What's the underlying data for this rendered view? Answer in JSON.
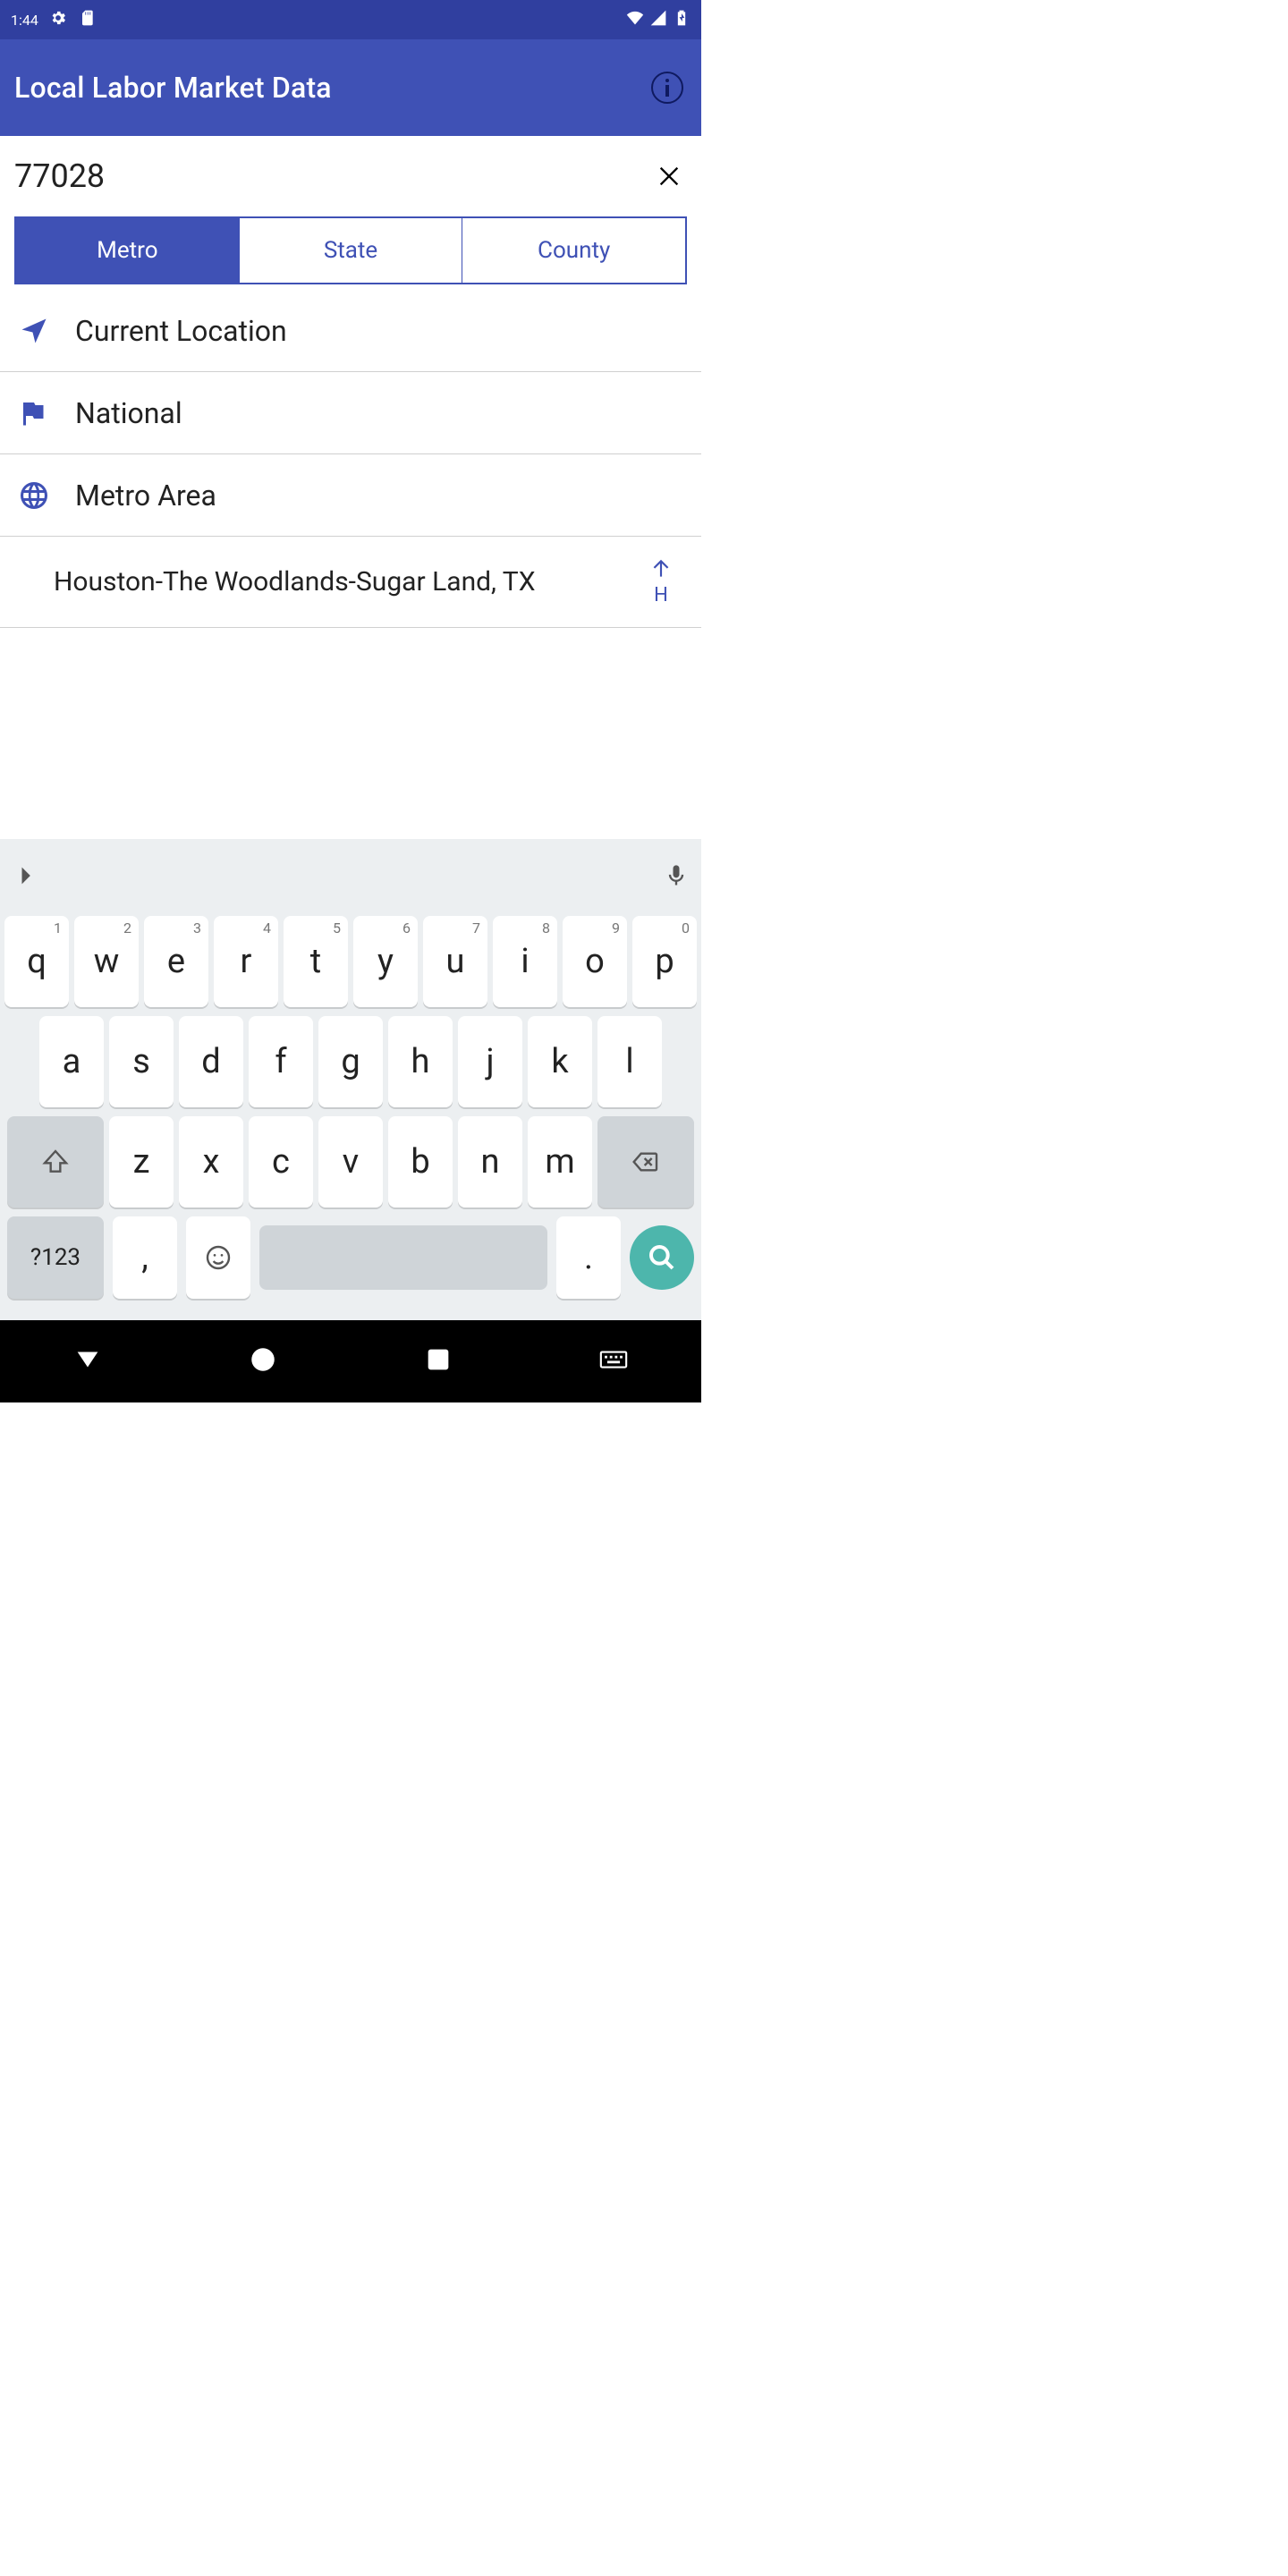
{
  "status": {
    "time": "1:44"
  },
  "app": {
    "title": "Local Labor Market Data"
  },
  "search": {
    "value": "77028"
  },
  "tabs": [
    {
      "label": "Metro",
      "active": true
    },
    {
      "label": "State",
      "active": false
    },
    {
      "label": "County",
      "active": false
    }
  ],
  "rows": {
    "current_location": "Current Location",
    "national": "National",
    "metro_area": "Metro Area"
  },
  "results": [
    {
      "label": "Houston-The Woodlands-Sugar Land, TX"
    }
  ],
  "section_index": {
    "letter": "H"
  },
  "keyboard": {
    "row1": [
      {
        "k": "q",
        "n": "1"
      },
      {
        "k": "w",
        "n": "2"
      },
      {
        "k": "e",
        "n": "3"
      },
      {
        "k": "r",
        "n": "4"
      },
      {
        "k": "t",
        "n": "5"
      },
      {
        "k": "y",
        "n": "6"
      },
      {
        "k": "u",
        "n": "7"
      },
      {
        "k": "i",
        "n": "8"
      },
      {
        "k": "o",
        "n": "9"
      },
      {
        "k": "p",
        "n": "0"
      }
    ],
    "row2": [
      "a",
      "s",
      "d",
      "f",
      "g",
      "h",
      "j",
      "k",
      "l"
    ],
    "row3": [
      "z",
      "x",
      "c",
      "v",
      "b",
      "n",
      "m"
    ],
    "symbols_label": "?123",
    "comma": ",",
    "period": "."
  }
}
